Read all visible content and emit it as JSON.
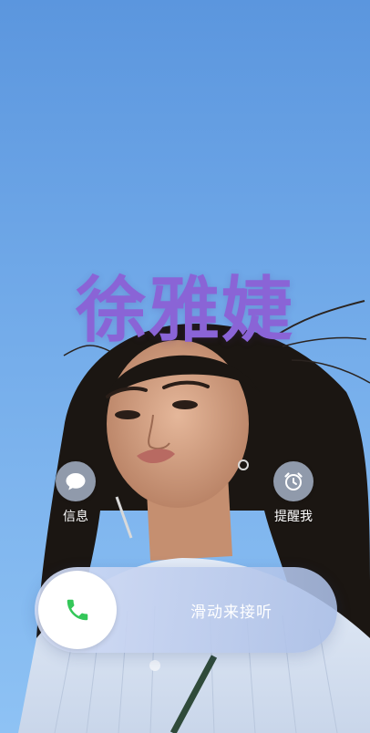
{
  "caller": {
    "name": "徐雅婕"
  },
  "actions": {
    "message": {
      "label": "信息",
      "icon": "message-bubble-icon"
    },
    "remind": {
      "label": "提醒我",
      "icon": "alarm-clock-icon"
    }
  },
  "answer": {
    "label": "滑动来接听",
    "icon": "phone-icon"
  },
  "colors": {
    "name": "#8a64d6",
    "accept": "#34c759",
    "sky_top": "#5f9be0",
    "sky_bottom": "#8cc1f5"
  }
}
